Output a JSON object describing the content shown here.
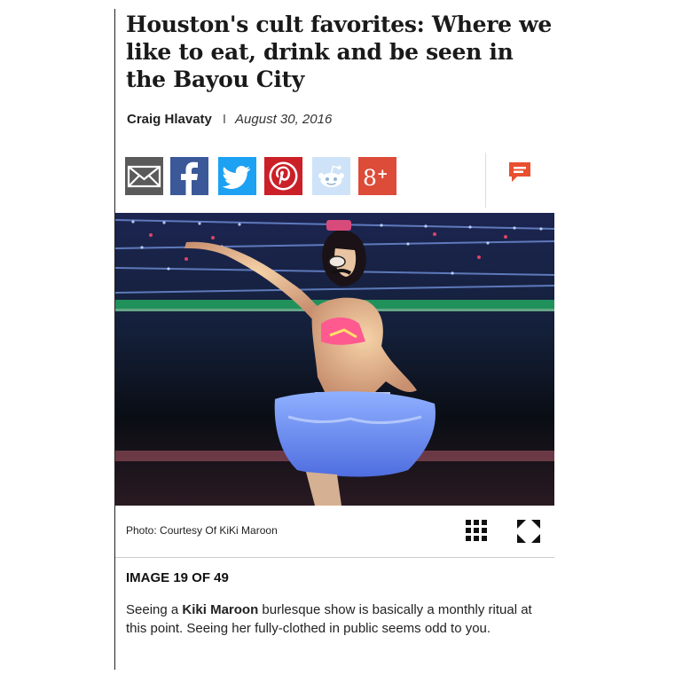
{
  "article": {
    "title": "Houston's cult favorites: Where we like to eat, drink and be seen in the Bayou City",
    "author": "Craig Hlavaty",
    "separator": "I",
    "date": "August 30, 2016"
  },
  "share_buttons": [
    {
      "name": "email",
      "icon": "envelope-icon",
      "color": "#5a5a5a"
    },
    {
      "name": "facebook",
      "icon": "facebook-icon",
      "color": "#3b5998"
    },
    {
      "name": "twitter",
      "icon": "twitter-bird-icon",
      "color": "#1da1f2"
    },
    {
      "name": "pinterest",
      "icon": "pinterest-icon",
      "color": "#cb2027"
    },
    {
      "name": "reddit",
      "icon": "reddit-alien-icon",
      "color": "#cee3f8"
    },
    {
      "name": "google-plus",
      "icon": "google-plus-icon",
      "color": "#dd4b39"
    }
  ],
  "comment_icon": {
    "icon": "comment-bubble-icon",
    "color": "#e8502f"
  },
  "gallery": {
    "photo_credit": "Photo: Courtesy Of KiKi Maroon",
    "counter": "IMAGE 19 OF 49",
    "caption_pre": "Seeing a ",
    "caption_name": "Kiki Maroon",
    "caption_post": " burlesque show is basically a monthly ritual at this point. Seeing her fully-clothed in public seems odd to you.",
    "grid_icon": "thumbnail-grid-icon",
    "expand_icon": "fullscreen-expand-icon"
  }
}
